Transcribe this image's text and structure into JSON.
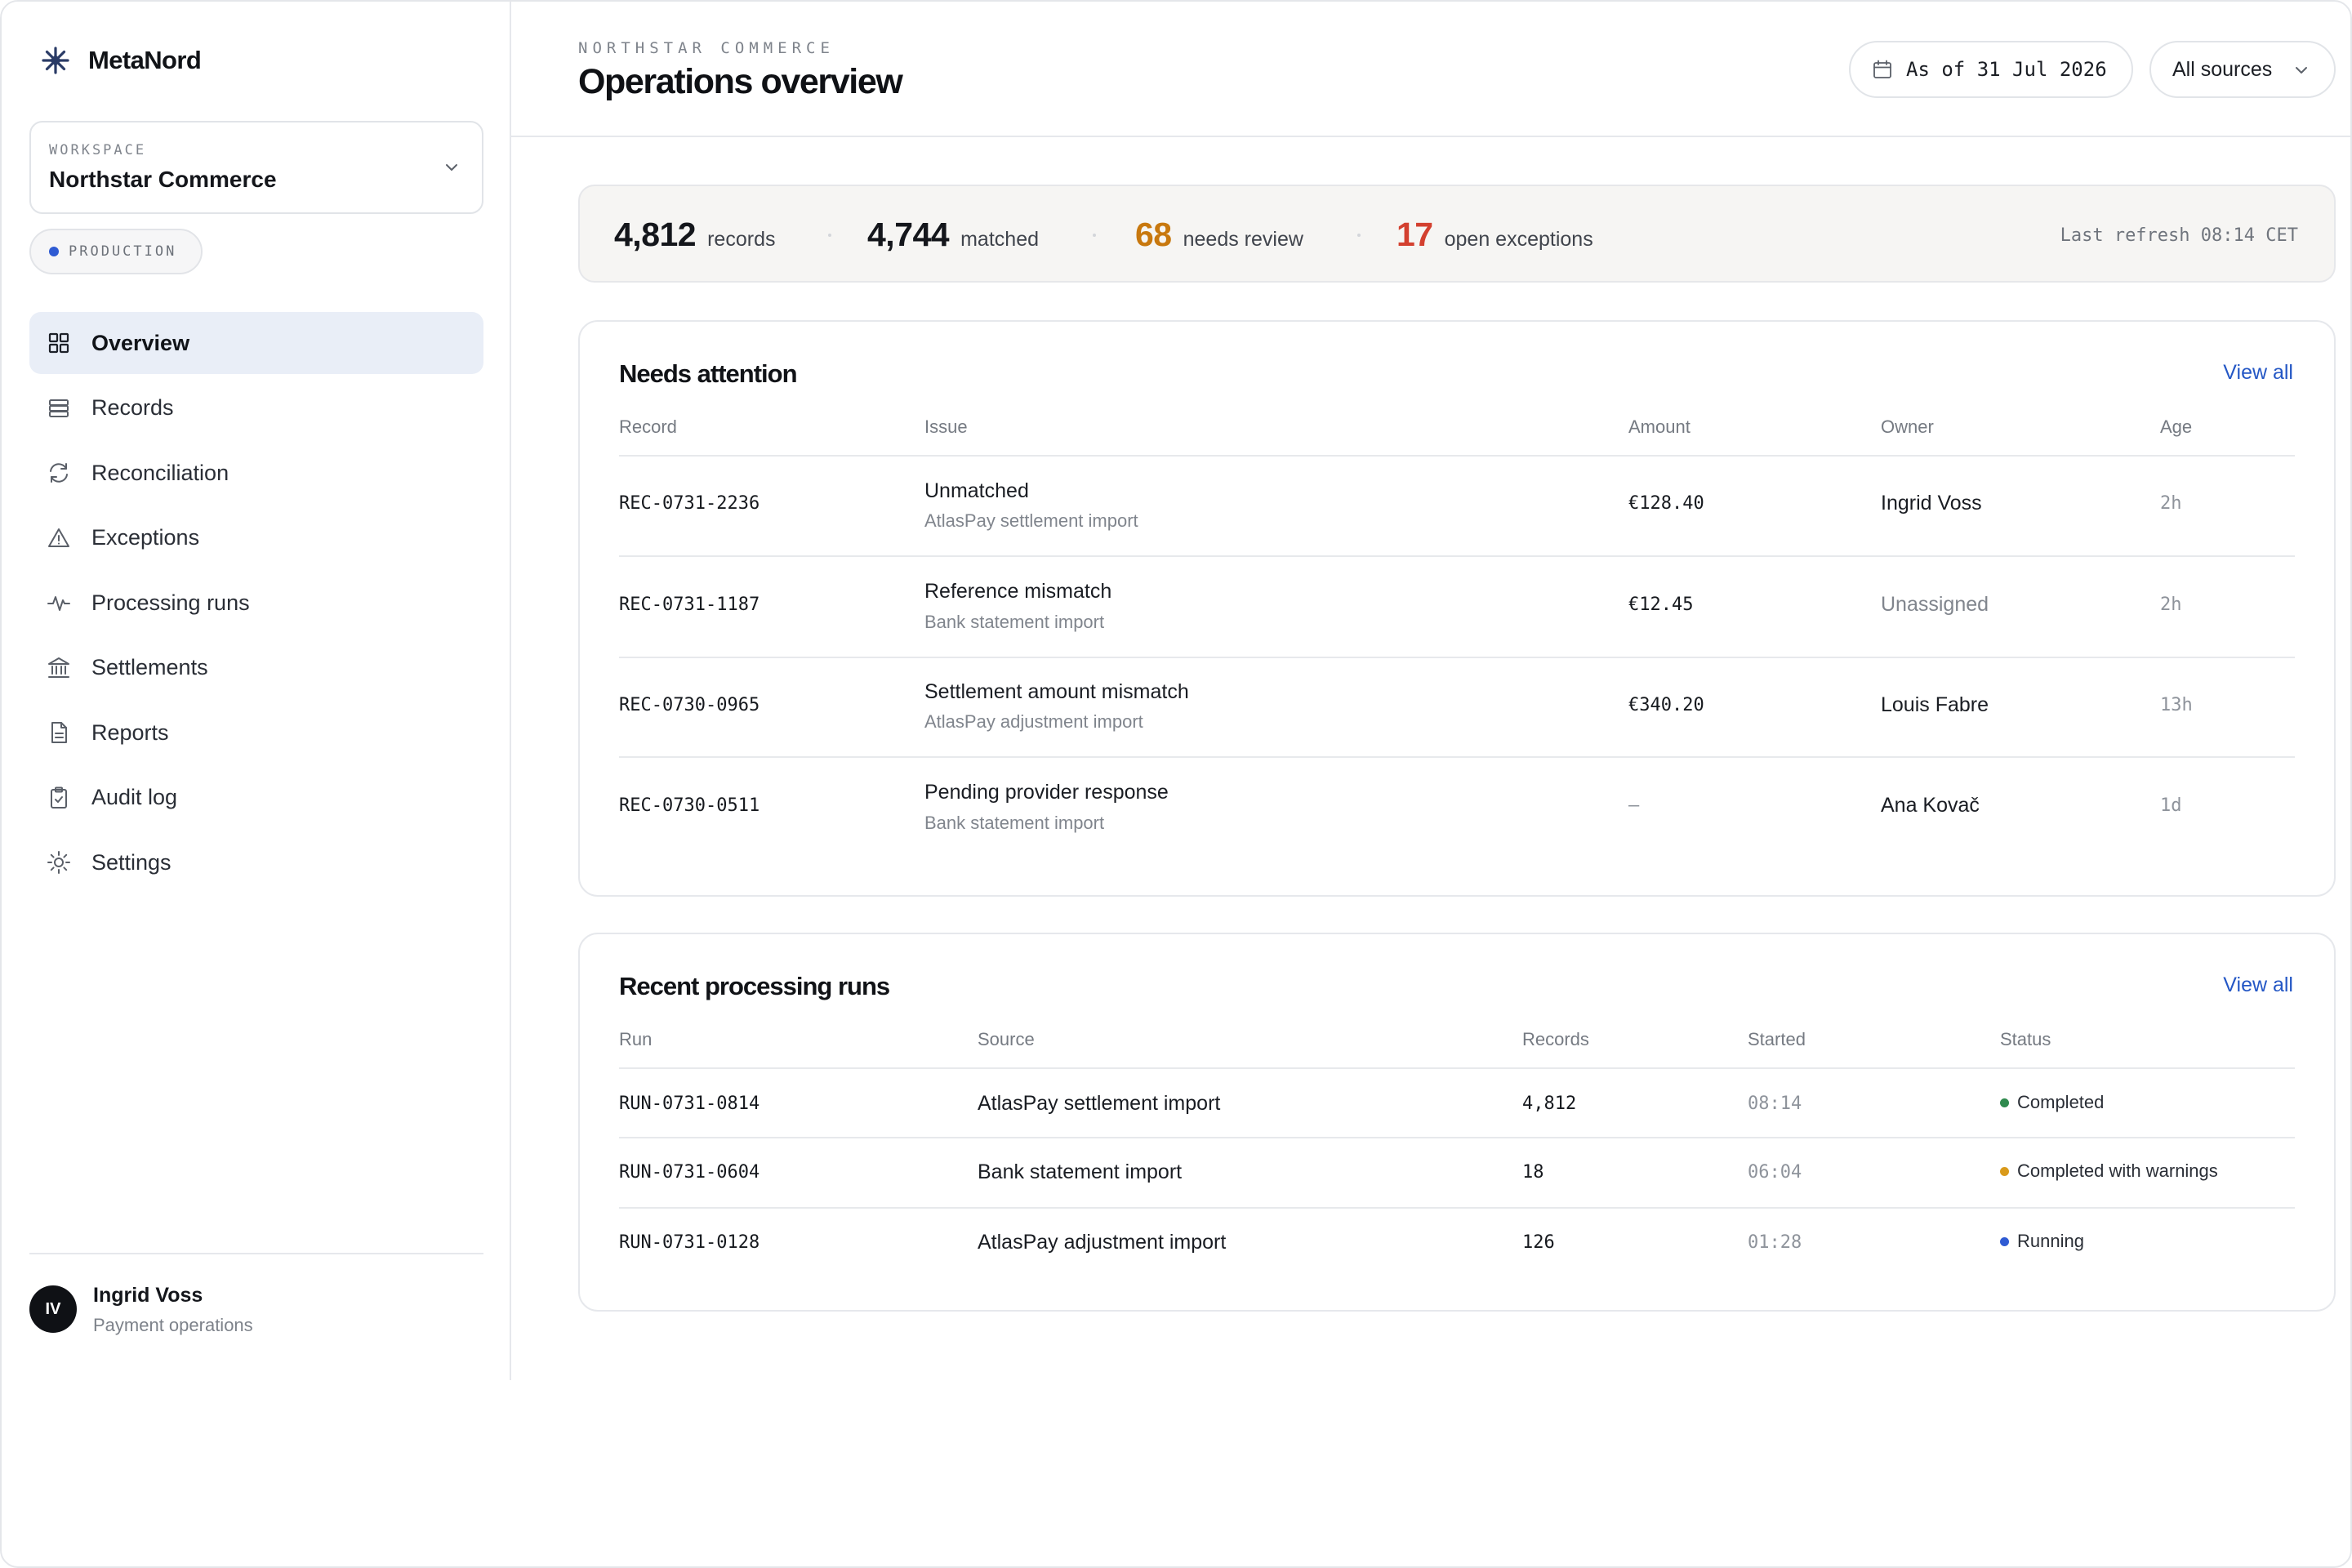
{
  "brand": {
    "name": "MetaNord",
    "icon": "snowflake-icon"
  },
  "workspace": {
    "label": "WORKSPACE",
    "name": "Northstar Commerce"
  },
  "environment": {
    "label": "PRODUCTION",
    "dot_color": "#2f5bd3"
  },
  "nav": [
    {
      "label": "Overview",
      "icon": "grid-icon",
      "active": true
    },
    {
      "label": "Records",
      "icon": "database-icon"
    },
    {
      "label": "Reconciliation",
      "icon": "refresh-icon"
    },
    {
      "label": "Exceptions",
      "icon": "warning-icon"
    },
    {
      "label": "Processing runs",
      "icon": "activity-icon"
    },
    {
      "label": "Settlements",
      "icon": "bank-icon"
    },
    {
      "label": "Reports",
      "icon": "document-icon"
    },
    {
      "label": "Audit log",
      "icon": "clipboard-icon"
    },
    {
      "label": "Settings",
      "icon": "gear-icon"
    }
  ],
  "user": {
    "initials": "IV",
    "name": "Ingrid Voss",
    "role": "Payment operations"
  },
  "header": {
    "eyebrow": "NORTHSTAR COMMERCE",
    "title": "Operations overview",
    "date_label": "As of 31 Jul 2026",
    "source_label": "All sources"
  },
  "summary": {
    "records": {
      "value": "4,812",
      "label": "records"
    },
    "matched": {
      "value": "4,744",
      "label": "matched"
    },
    "needs_review": {
      "value": "68",
      "label": "needs review",
      "color": "#c8780e"
    },
    "exceptions": {
      "value": "17",
      "label": "open exceptions",
      "color": "#d3402f"
    },
    "refresh": "Last refresh 08:14 CET"
  },
  "attention": {
    "title": "Needs attention",
    "view_all": "View all",
    "columns": [
      "Record",
      "Issue",
      "Amount",
      "Owner",
      "Age"
    ],
    "rows": [
      {
        "record": "REC-0731-2236",
        "issue": "Unmatched",
        "source": "AtlasPay settlement import",
        "amount": "€128.40",
        "owner": "Ingrid Voss",
        "age": "2h"
      },
      {
        "record": "REC-0731-1187",
        "issue": "Reference mismatch",
        "source": "Bank statement import",
        "amount": "€12.45",
        "owner": "Unassigned",
        "age": "2h"
      },
      {
        "record": "REC-0730-0965",
        "issue": "Settlement amount mismatch",
        "source": "AtlasPay adjustment import",
        "amount": "€340.20",
        "owner": "Louis Fabre",
        "age": "13h"
      },
      {
        "record": "REC-0730-0511",
        "issue": "Pending provider response",
        "source": "Bank statement import",
        "amount": "–",
        "owner": "Ana Kovač",
        "age": "1d"
      }
    ]
  },
  "runs": {
    "title": "Recent processing runs",
    "view_all": "View all",
    "columns": [
      "Run",
      "Source",
      "Records",
      "Started",
      "Status"
    ],
    "rows": [
      {
        "run": "RUN-0731-0814",
        "source": "AtlasPay settlement import",
        "records": "4,812",
        "started": "08:14",
        "status": "Completed",
        "status_color": "#2f8a4e"
      },
      {
        "run": "RUN-0731-0604",
        "source": "Bank statement import",
        "records": "18",
        "started": "06:04",
        "status": "Completed with warnings",
        "status_color": "#d99a1b"
      },
      {
        "run": "RUN-0731-0128",
        "source": "AtlasPay adjustment import",
        "records": "126",
        "started": "01:28",
        "status": "Running",
        "status_color": "#2f5bd3"
      }
    ]
  }
}
